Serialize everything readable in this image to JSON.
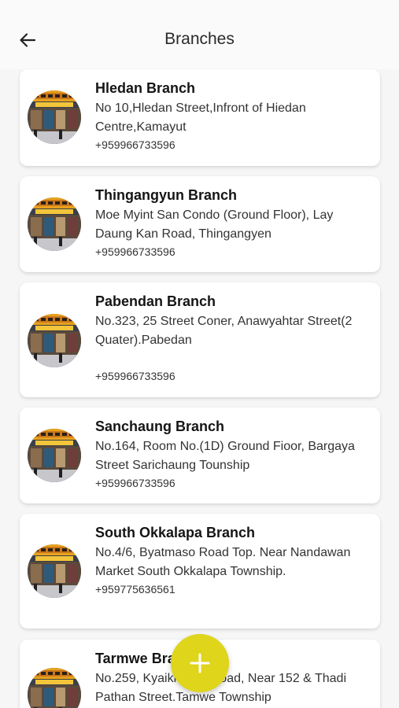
{
  "header": {
    "title": "Branches",
    "back_icon": "arrow-left-icon"
  },
  "branches": [
    {
      "name": "Hledan Branch",
      "address": "No 10,Hledan Street,Infront of Hiedan Centre,Kamayut",
      "phone": "+959966733596",
      "image": "storefront-photo"
    },
    {
      "name": "Thingangyun Branch",
      "address": "Moe Myint San Condo (Ground Floor), Lay Daung Kan Road, Thingangyen",
      "phone": "+959966733596",
      "image": "storefront-photo"
    },
    {
      "name": "Pabendan Branch",
      "address": "No.323, 25 Street Coner, Anawyahtar Street(2 Quater).Pabedan",
      "phone": "+959966733596",
      "image": "storefront-photo"
    },
    {
      "name": "Sanchaung Branch",
      "address": "No.164, Room No.(1D) Ground Fioor, Bargaya Street Sarichaung Tounship",
      "phone": "+959966733596",
      "image": "storefront-photo"
    },
    {
      "name": "South Okkalapa Branch",
      "address": "No.4/6, Byatmaso Road Top. Near Nandawan Market South Okkalapa Township.",
      "phone": "+959775636561",
      "image": "storefront-photo"
    },
    {
      "name": "Tarmwe Branch",
      "address": "No.259, Kyaikkasan Road, Near 152 & Thadi Pathan Street.Tamwe Township",
      "phone": "",
      "image": "storefront-photo"
    }
  ],
  "fab": {
    "icon": "plus-icon",
    "color": "#dfd51a"
  },
  "colors": {
    "background": "#f6f6f6",
    "card": "#ffffff",
    "accent": "#dfd51a"
  }
}
